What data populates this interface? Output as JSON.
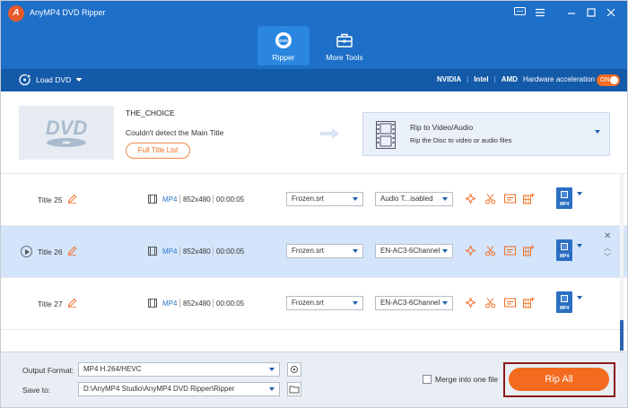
{
  "app": {
    "title": "AnyMP4 DVD Ripper",
    "logo_letter": "A"
  },
  "nav": {
    "tabs": [
      {
        "label": "Ripper",
        "icon": "disc-icon",
        "active": true
      },
      {
        "label": "More Tools",
        "icon": "toolbox-icon",
        "active": false
      }
    ]
  },
  "toolbar": {
    "load_dvd": "Load DVD",
    "gpu": [
      "NVIDIA",
      "Intel",
      "AMD"
    ],
    "hw_accel": "Hardware acceleration",
    "toggle": "ON"
  },
  "source": {
    "disc_name": "THE_CHOICE",
    "message": "Couldn't detect the Main Title",
    "full_title_list": "Full Title List",
    "rip_to": {
      "title": "Rip to Video/Audio",
      "subtitle": "Rip the Disc to video or audio files"
    }
  },
  "titles": [
    {
      "name": "Title 25",
      "format": "MP4",
      "resolution": "852x480",
      "duration": "00:00:05",
      "subtitle": "Frozen.srt",
      "audio": "Audio T...isabled",
      "selected": false
    },
    {
      "name": "Title 26",
      "format": "MP4",
      "resolution": "852x480",
      "duration": "00:00:05",
      "subtitle": "Frozen.srt",
      "audio": "EN-AC3-6Channel",
      "selected": true
    },
    {
      "name": "Title 27",
      "format": "MP4",
      "resolution": "852x480",
      "duration": "00:00:05",
      "subtitle": "Frozen.srt",
      "audio": "EN-AC3-6Channel",
      "selected": false
    }
  ],
  "output_badge": "MP4",
  "footer": {
    "output_format_label": "Output Format:",
    "output_format_value": "MP4 H.264/HEVC",
    "save_to_label": "Save to:",
    "save_to_value": "D:\\AnyMP4 Studio\\AnyMP4 DVD Ripper\\Ripper",
    "merge_label": "Merge into one file",
    "rip_all": "Rip All"
  },
  "colors": {
    "header": "#1d6fc8",
    "toolbar": "#135aa9",
    "accent": "#f36b1e",
    "selected_row": "#d4e5fb"
  }
}
